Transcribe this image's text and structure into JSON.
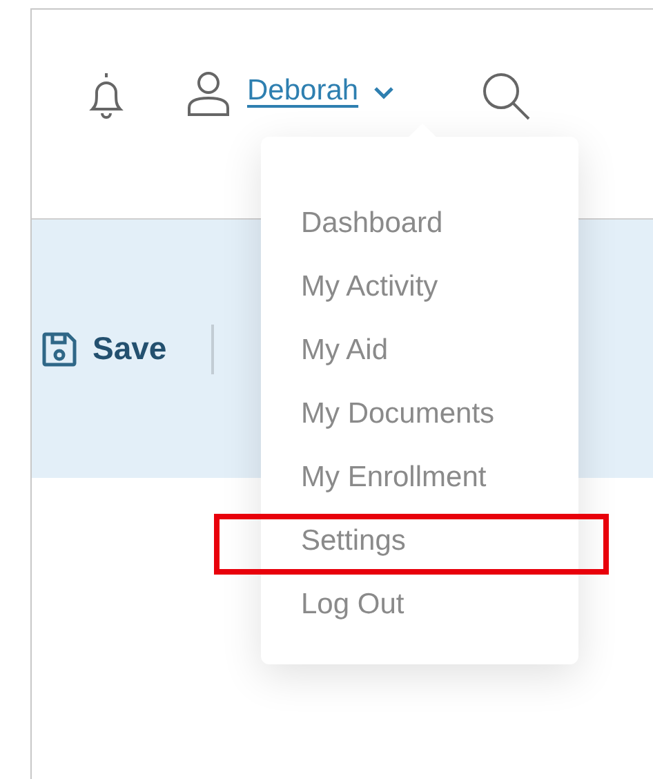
{
  "header": {
    "user_name": "Deborah"
  },
  "toolbar": {
    "save_label": "Save"
  },
  "user_menu": {
    "open": true,
    "items": [
      {
        "label": "Dashboard",
        "highlighted": false
      },
      {
        "label": "My Activity",
        "highlighted": false
      },
      {
        "label": "My Aid",
        "highlighted": false
      },
      {
        "label": "My Documents",
        "highlighted": false
      },
      {
        "label": "My Enrollment",
        "highlighted": false
      },
      {
        "label": "Settings",
        "highlighted": true
      },
      {
        "label": "Log Out",
        "highlighted": false
      }
    ]
  }
}
